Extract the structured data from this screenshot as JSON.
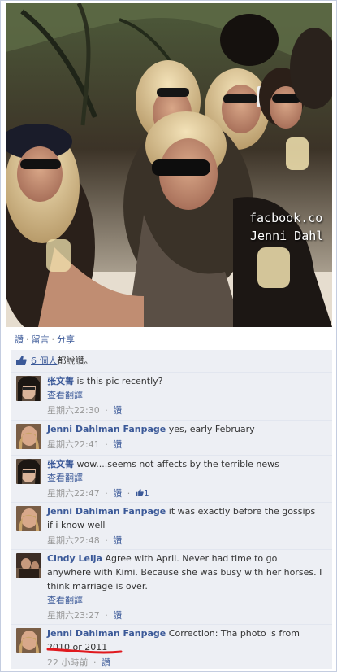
{
  "photo": {
    "watermark_line1": "facbook.co",
    "watermark_line2": "Jenni Dahl"
  },
  "actions": {
    "like": "讚",
    "comment": "留言",
    "share": "分享",
    "separator": "·"
  },
  "likes": {
    "count_link": "6 個人",
    "suffix": "都說讚。"
  },
  "comments": [
    {
      "author": "张文菁",
      "text": "is this pic recently?",
      "translate": "查看翻譯",
      "time": "星期六22:30",
      "like": "讚"
    },
    {
      "author": "Jenni Dahlman Fanpage",
      "text": "yes, early February",
      "time": "星期六22:41",
      "like": "讚"
    },
    {
      "author": "张文菁",
      "text": "wow....seems not affects by the terrible news",
      "translate": "查看翻譯",
      "time": "星期六22:47",
      "like": "讚",
      "like_count": "1"
    },
    {
      "author": "Jenni Dahlman Fanpage",
      "text_line1": "it was exactly before the gossips",
      "text_line2": "if i know well",
      "time": "星期六22:48",
      "like": "讚"
    },
    {
      "author": "Cindy Leija",
      "text_line1": "Agree with April. Never had time to go",
      "text_line2": "anywhere with Kimi. Because she was busy with her horses. I",
      "text_line3": "think marriage is over.",
      "translate": "查看翻譯",
      "time": "星期六23:27",
      "like": "讚"
    },
    {
      "author": "Jenni Dahlman Fanpage",
      "text_line1": "Correction: Tha photo is from",
      "text_line2": "2010 or 2011",
      "time": "22 小時前",
      "like": "讚"
    }
  ],
  "colors": {
    "link": "#3b5998",
    "feed_bg": "#edeff4",
    "meta": "#999999",
    "annotation": "#e0191e"
  }
}
